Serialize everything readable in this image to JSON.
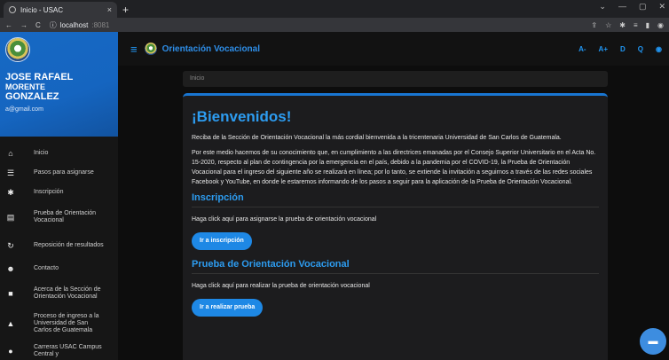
{
  "browser": {
    "tab_title": "Inicio - USAC",
    "tab_close": "×",
    "new_tab": "+",
    "url_host": "localhost",
    "url_port": ":8081",
    "window_controls": [
      "⌄",
      "—",
      "▢",
      "✕"
    ],
    "nav_icons": [
      "←",
      "→",
      "C"
    ],
    "ext_icons": [
      "⇪",
      "☆",
      "✱",
      "≡",
      "▮",
      "◉"
    ]
  },
  "sidebar": {
    "user_first": "JOSE RAFAEL",
    "user_middle": "MORENTE",
    "user_last": "GONZALEZ",
    "email": "a@gmail.com",
    "items": [
      {
        "icon": "home-icon",
        "glyph": "⌂",
        "label": "Inicio"
      },
      {
        "icon": "list-icon",
        "glyph": "☰",
        "label": "Pasos para asignarse"
      },
      {
        "icon": "gear-icon",
        "glyph": "✱",
        "label": "Inscripción"
      },
      {
        "icon": "clipboard-icon",
        "glyph": "▤",
        "label": "Prueba de Orientación Vocacional"
      },
      {
        "icon": "history-icon",
        "glyph": "↻",
        "label": "Reposición de resultados"
      },
      {
        "icon": "people-icon",
        "glyph": "☻",
        "label": "Contacto"
      },
      {
        "icon": "info-icon",
        "glyph": "■",
        "label": "Acerca de la Sección de Orientación Vocacional"
      },
      {
        "icon": "graduation-icon",
        "glyph": "▲",
        "label": "Proceso de ingreso a la Universidad de San Carlos de Guatemala"
      },
      {
        "icon": "map-pin-icon",
        "glyph": "●",
        "label": "Carreras USAC Campus Central y"
      }
    ]
  },
  "topbar": {
    "title": "Orientación Vocacional",
    "menu_glyph": "≡",
    "right": [
      "A-",
      "A+",
      "D",
      "Q",
      "◉"
    ]
  },
  "breadcrumb": "Inicio",
  "main": {
    "heading": "¡Bienvenidos!",
    "p1": "Reciba de la Sección de Orientación Vocacional la más cordial bienvenida a la tricentenaria Universidad de San Carlos de Guatemala.",
    "p2": "Por este medio hacemos de su conocimiento que, en cumplimiento a las directrices emanadas por el Consejo Superior Universitario en el Acta No. 15-2020, respecto al plan de contingencia por la emergencia en el país, debido a la pandemia por el COVID-19, la Prueba de Orientación Vocacional para el ingreso del siguiente año se realizará en línea; por lo tanto, se extiende la invitación a seguirnos a través de las redes sociales Facebook y YouTube, en donde le estaremos informando de los pasos a seguir para la aplicación de la Prueba de Orientación Vocacional.",
    "section1_title": "Inscripción",
    "section1_text": "Haga click aquí para asignarse la prueba de orientación vocacional",
    "section1_button": "Ir a inscripción",
    "section2_title": "Prueba de Orientación Vocacional",
    "section2_text": "Haga click aquí para realizar la prueba de orientación vocacional",
    "section2_button": "Ir a realizar prueba"
  },
  "fab_glyph": "▬",
  "colors": {
    "accent": "#1e88e5",
    "header_blue": "#1565c0",
    "background": "#0d0d0d"
  }
}
